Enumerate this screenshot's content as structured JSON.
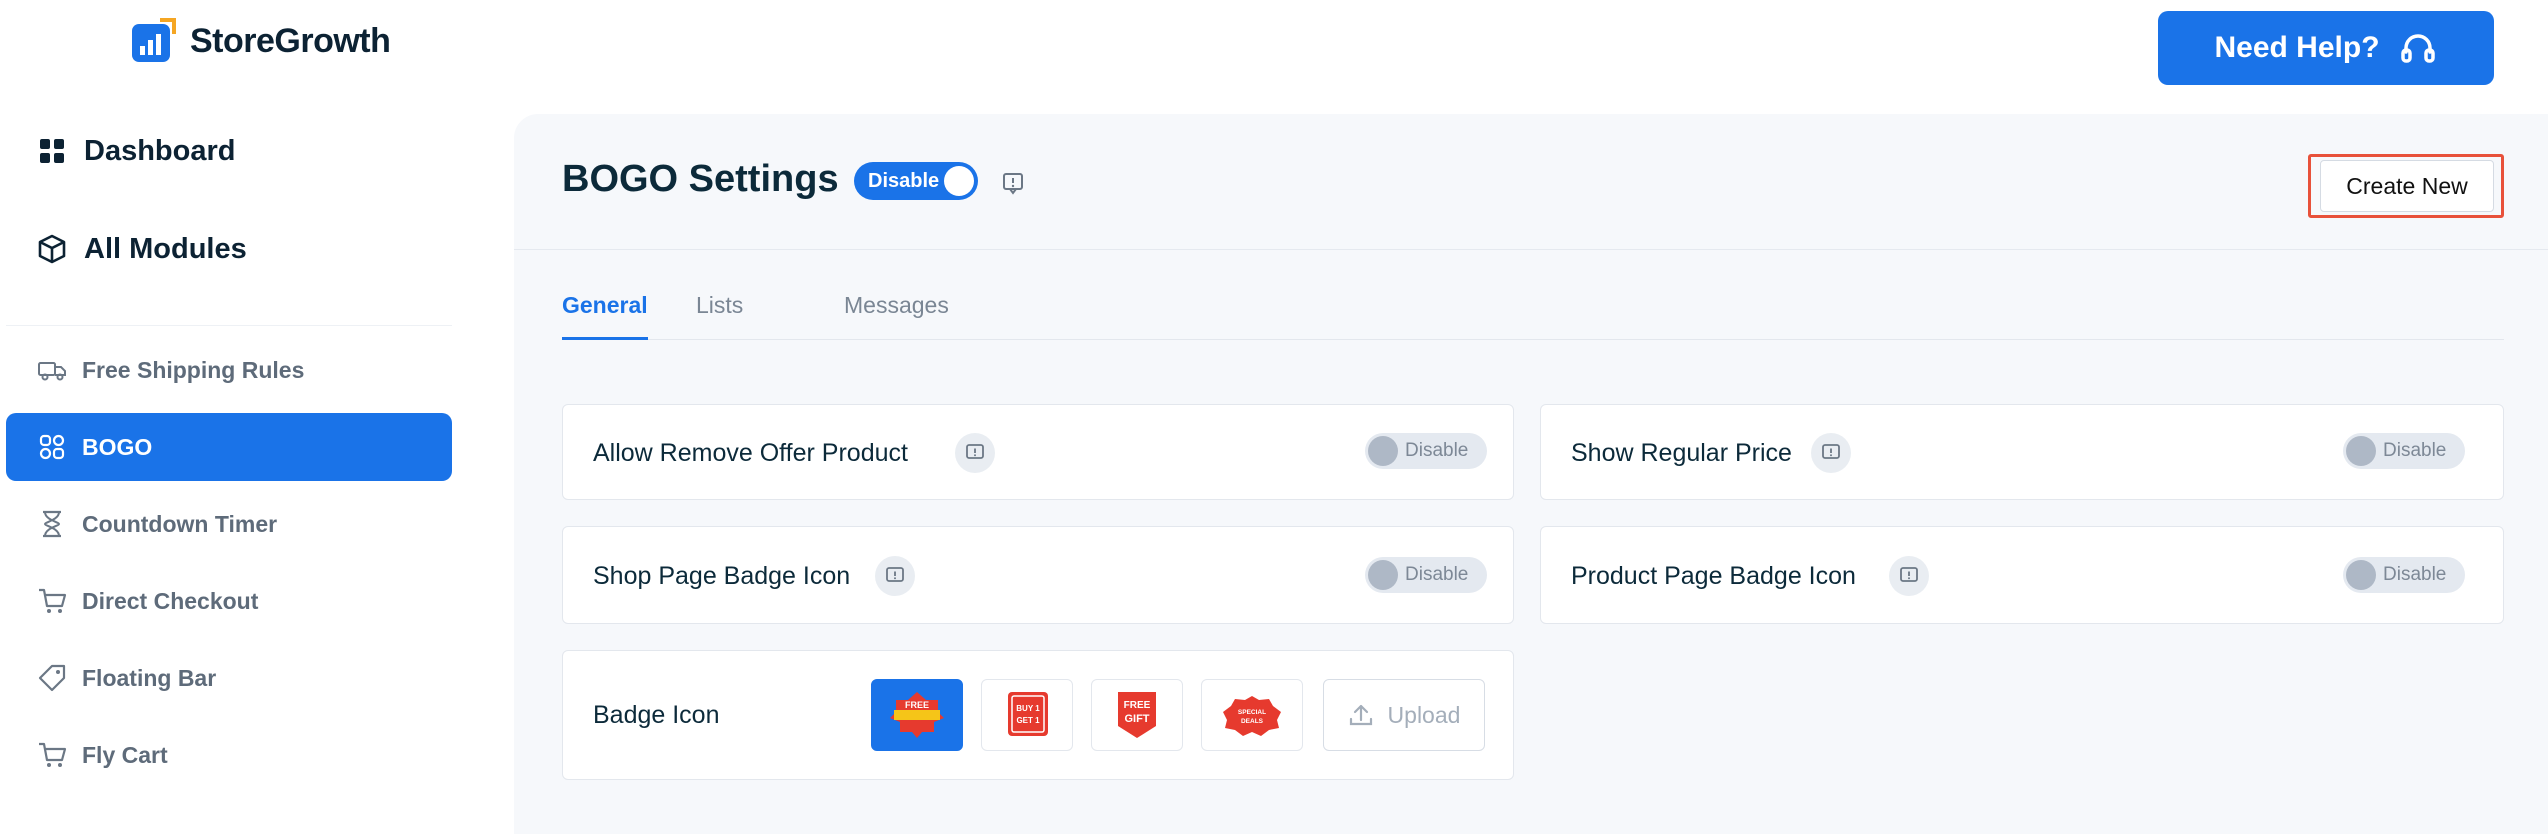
{
  "brand": {
    "name": "StoreGrowth",
    "accent": "#1a73e8"
  },
  "header": {
    "help_label": "Need Help?"
  },
  "sidebar": {
    "main": [
      {
        "label": "Dashboard",
        "icon": "grid-icon"
      },
      {
        "label": "All Modules",
        "icon": "cube-icon"
      }
    ],
    "items": [
      {
        "label": "Free Shipping Rules",
        "icon": "truck-icon"
      },
      {
        "label": "BOGO",
        "icon": "bogo-icon",
        "active": true
      },
      {
        "label": "Countdown Timer",
        "icon": "hourglass-icon"
      },
      {
        "label": "Direct Checkout",
        "icon": "cart-icon"
      },
      {
        "label": "Floating Bar",
        "icon": "tag-icon"
      },
      {
        "label": "Fly Cart",
        "icon": "cart-icon"
      }
    ]
  },
  "page": {
    "title": "BOGO Settings",
    "status_toggle": "Disable",
    "create_label": "Create New",
    "tabs": [
      {
        "label": "General",
        "active": true
      },
      {
        "label": "Lists"
      },
      {
        "label": "Messages"
      }
    ]
  },
  "settings": {
    "allow_remove": {
      "label": "Allow Remove Offer Product",
      "toggle": "Disable"
    },
    "show_regular": {
      "label": "Show Regular Price",
      "toggle": "Disable"
    },
    "shop_badge": {
      "label": "Shop Page Badge Icon",
      "toggle": "Disable"
    },
    "product_badge": {
      "label": "Product Page Badge Icon",
      "toggle": "Disable"
    },
    "badge_icon": {
      "label": "Badge Icon",
      "options": [
        "FREE",
        "BUY 1 GET 1",
        "FREE GIFT",
        "SPECIAL DEALS"
      ],
      "upload_label": "Upload"
    }
  }
}
